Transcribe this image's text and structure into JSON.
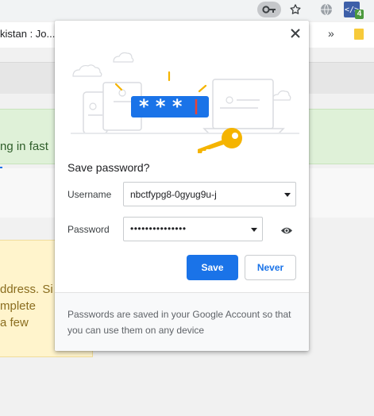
{
  "toolbar": {
    "extension_badge": "4",
    "extension_glyph": "</>"
  },
  "bookmarks": {
    "first_item": "kistan : Jo...",
    "overflow": "»"
  },
  "background_page": {
    "green_banner_text": "ng in fast",
    "yellow_card_lines": [
      "ddress. Si",
      "mplete",
      " a few"
    ]
  },
  "popup": {
    "title": "Save password?",
    "username_label": "Username",
    "username_value": "nbctfypg8-0gyug9u-j",
    "password_label": "Password",
    "password_value": "•••••••••••••••",
    "save_label": "Save",
    "never_label": "Never",
    "footer": "Passwords are saved in your Google Account so that you can use them on any device",
    "illustration_mask": "* * *"
  },
  "colors": {
    "accent": "#1a73e8",
    "key_gold": "#f5b400",
    "banner_green": "#dff1d8",
    "card_yellow": "#fff4cc"
  }
}
